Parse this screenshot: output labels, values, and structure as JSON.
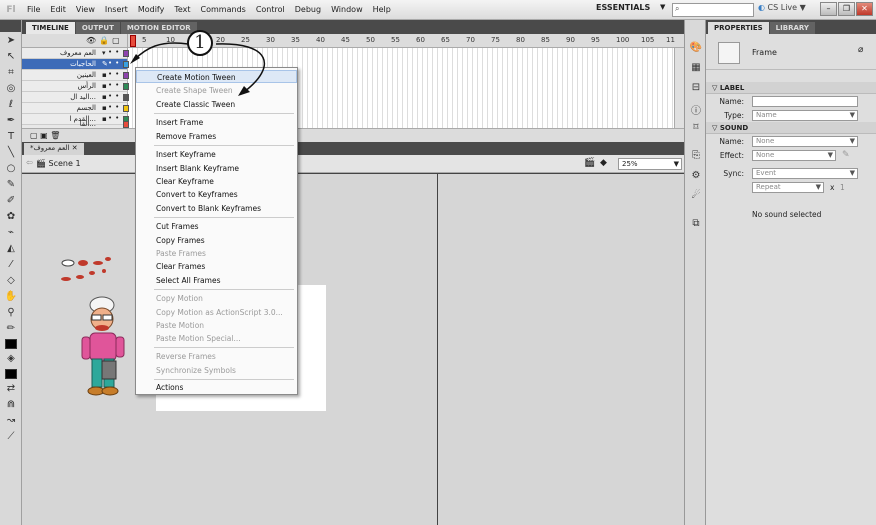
{
  "menubar": {
    "logo": "Fl",
    "items": [
      "File",
      "Edit",
      "View",
      "Insert",
      "Modify",
      "Text",
      "Commands",
      "Control",
      "Debug",
      "Window",
      "Help"
    ],
    "workspace": "ESSENTIALS",
    "cs_live": "CS Live"
  },
  "timeline": {
    "tabs": [
      "TIMELINE",
      "OUTPUT",
      "MOTION EDITOR"
    ],
    "layers": [
      {
        "name": "العم معروف",
        "color": "#8e44ad"
      },
      {
        "name": "الحاجبات",
        "color": "#3aa0e0"
      },
      {
        "name": "العينين",
        "color": "#8e44ad"
      },
      {
        "name": "الرأس",
        "color": "#2e8b57"
      },
      {
        "name": "...اليد ال",
        "color": "#555555"
      },
      {
        "name": "الجسم",
        "color": "#f1c40f"
      },
      {
        "name": "...القدم ا",
        "color": "#2e8b57"
      },
      {
        "name": "...القا",
        "color": "#e74c3c"
      }
    ],
    "ruler": [
      "5",
      "10",
      "15",
      "20",
      "25",
      "30",
      "35",
      "40",
      "45",
      "50",
      "55",
      "60",
      "65",
      "70",
      "75",
      "80",
      "85",
      "90",
      "95",
      "100",
      "105",
      "11"
    ]
  },
  "document": {
    "tab": "*العم معروف",
    "scene": "Scene 1",
    "zoom": "25%"
  },
  "context_menu": {
    "items": [
      {
        "label": "Create Motion Tween",
        "disabled": false
      },
      {
        "label": "Create Shape Tween",
        "disabled": true
      },
      {
        "label": "Create Classic Tween",
        "disabled": false
      },
      {
        "label": "Insert Frame",
        "disabled": false
      },
      {
        "label": "Remove Frames",
        "disabled": false
      },
      {
        "label": "Insert Keyframe",
        "disabled": false
      },
      {
        "label": "Insert Blank Keyframe",
        "disabled": false
      },
      {
        "label": "Clear Keyframe",
        "disabled": false
      },
      {
        "label": "Convert to Keyframes",
        "disabled": false
      },
      {
        "label": "Convert to Blank Keyframes",
        "disabled": false
      },
      {
        "label": "Cut Frames",
        "disabled": false
      },
      {
        "label": "Copy Frames",
        "disabled": false
      },
      {
        "label": "Paste Frames",
        "disabled": true
      },
      {
        "label": "Clear Frames",
        "disabled": false
      },
      {
        "label": "Select All Frames",
        "disabled": false
      },
      {
        "label": "Copy Motion",
        "disabled": true
      },
      {
        "label": "Copy Motion as ActionScript 3.0...",
        "disabled": true
      },
      {
        "label": "Paste Motion",
        "disabled": true
      },
      {
        "label": "Paste Motion Special...",
        "disabled": true
      },
      {
        "label": "Reverse Frames",
        "disabled": true
      },
      {
        "label": "Synchronize Symbols",
        "disabled": true
      },
      {
        "label": "Actions",
        "disabled": false
      }
    ]
  },
  "annotation": {
    "number": "1"
  },
  "properties": {
    "tabs": [
      "PROPERTIES",
      "LIBRARY"
    ],
    "title": "Frame",
    "label_section": "LABEL",
    "name_label": "Name:",
    "type_label": "Type:",
    "type_value": "Name",
    "sound_section": "SOUND",
    "sound_name_value": "None",
    "effect_label": "Effect:",
    "effect_value": "None",
    "sync_label": "Sync:",
    "sync_value": "Event",
    "repeat_value": "Repeat",
    "repeat_x": "x",
    "repeat_count": "1",
    "no_sound": "No sound selected"
  }
}
